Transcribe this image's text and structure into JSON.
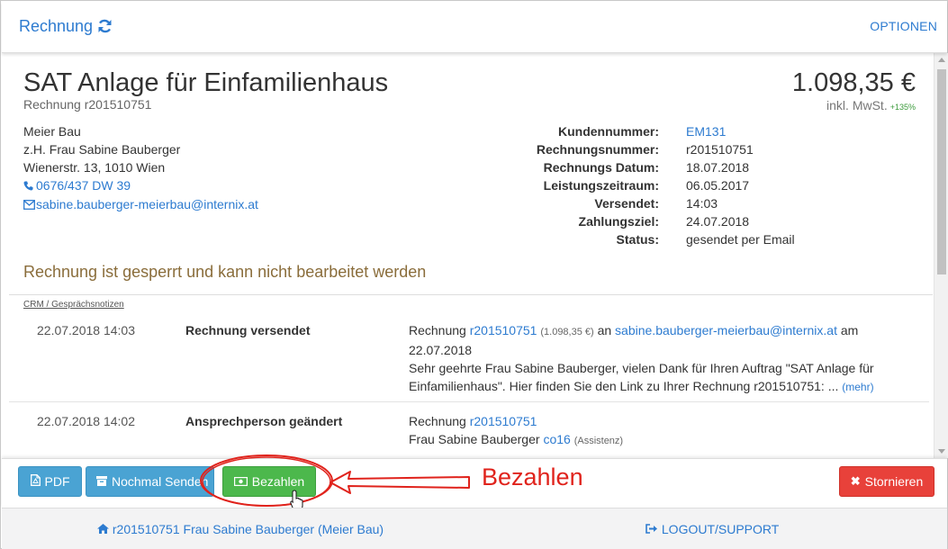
{
  "header": {
    "title": "Rechnung",
    "options": "OPTIONEN"
  },
  "invoice": {
    "title": "SAT Anlage für Einfamilienhaus",
    "subtitle": "Rechnung r201510751",
    "amount": "1.098,35 €",
    "amount_note": "inkl. MwSt.",
    "amount_pct": "+135%"
  },
  "customer": {
    "company": "Meier Bau",
    "contact": "z.H. Frau Sabine Bauberger",
    "street": "Wienerstr. 13, 1010 Wien",
    "phone": "0676/437 DW 39",
    "email": "sabine.bauberger-meierbau@internix.at"
  },
  "details": {
    "labels": [
      "Kundennummer:",
      "Rechnungsnummer:",
      "Rechnungs Datum:",
      "Leistungszeitraum:",
      "Versendet:",
      "Zahlungsziel:",
      "Status:"
    ],
    "values": [
      "EM131",
      "r201510751",
      "18.07.2018",
      "06.05.2017",
      "14:03",
      "24.07.2018",
      "gesendet per Email"
    ]
  },
  "locked_message": "Rechnung ist gesperrt und kann nicht bearbeitet werden",
  "crm": {
    "label": "CRM / Gesprächsnotizen",
    "entries": [
      {
        "date": "22.07.2018 14:03",
        "action": "Rechnung versendet",
        "t1": "Rechnung ",
        "link1": "r201510751",
        "amount": "(1.098,35 €)",
        "t2": " an ",
        "email": "sabine.bauberger-meierbau@internix.at",
        "t3": " am",
        "line2": "22.07.2018",
        "line3": "Sehr geehrte Frau Sabine Bauberger, vielen Dank für Ihren Auftrag \"SAT Anlage für",
        "line4": "Einfamilienhaus\". Hier finden Sie den Link zu Ihrer Rechnung r201510751: ...",
        "more": "(mehr)"
      },
      {
        "date": "22.07.2018 14:02",
        "action": "Ansprechperson geändert",
        "t1": "Rechnung ",
        "link1": "r201510751",
        "line2": "Frau Sabine Bauberger ",
        "link2": "co16",
        "note": "(Assistenz)"
      }
    ]
  },
  "actions": {
    "pdf": "PDF",
    "resend": "Nochmal Senden",
    "pay": "Bezahlen",
    "cancel": "Stornieren"
  },
  "annotation": {
    "text": "Bezahlen"
  },
  "footer": {
    "left": "r201510751 Frau Sabine Bauberger (Meier Bau)",
    "right": "LOGOUT/SUPPORT"
  },
  "colors": {
    "link": "#2d7bd0",
    "info": "#4aa3d3",
    "success": "#4cb84c",
    "danger": "#e8413a",
    "annotation": "#e0231c",
    "warning_text": "#8a6d3b"
  }
}
